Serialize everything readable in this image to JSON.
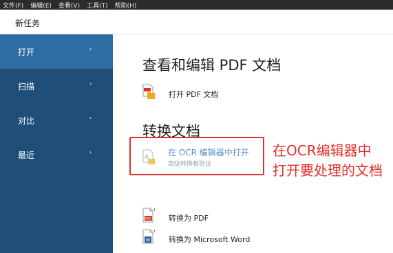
{
  "menubar": {
    "items": [
      "文件(F)",
      "编辑(E)",
      "查看(V)",
      "工具(T)",
      "帮助(H)"
    ]
  },
  "taskbar": {
    "title": "新任务"
  },
  "sidebar": {
    "items": [
      {
        "label": "打开",
        "arrow": "›"
      },
      {
        "label": "扫描",
        "arrow": "›"
      },
      {
        "label": "对比",
        "arrow": "›"
      },
      {
        "label": "最近",
        "arrow": "›"
      }
    ]
  },
  "main": {
    "section1_title": "查看和编辑 PDF 文档",
    "open_pdf": "打开 PDF 文档",
    "section2_title": "转换文档",
    "ocr_open": "在 OCR 编辑器中打开",
    "ocr_sub": "高级转换和验证",
    "to_pdf": "转换为 PDF",
    "to_word": "转换为 Microsoft Word"
  },
  "annotation": {
    "line1": "在OCR编辑器中",
    "line2": "打开要处理的文档"
  },
  "icons": {
    "pdf_badge": "PDF",
    "word_badge": "W"
  },
  "colors": {
    "sidebar": "#1f4e79",
    "sidebar_active": "#2e6da4",
    "highlight": "#e0302a",
    "link": "#5b8fc7"
  }
}
